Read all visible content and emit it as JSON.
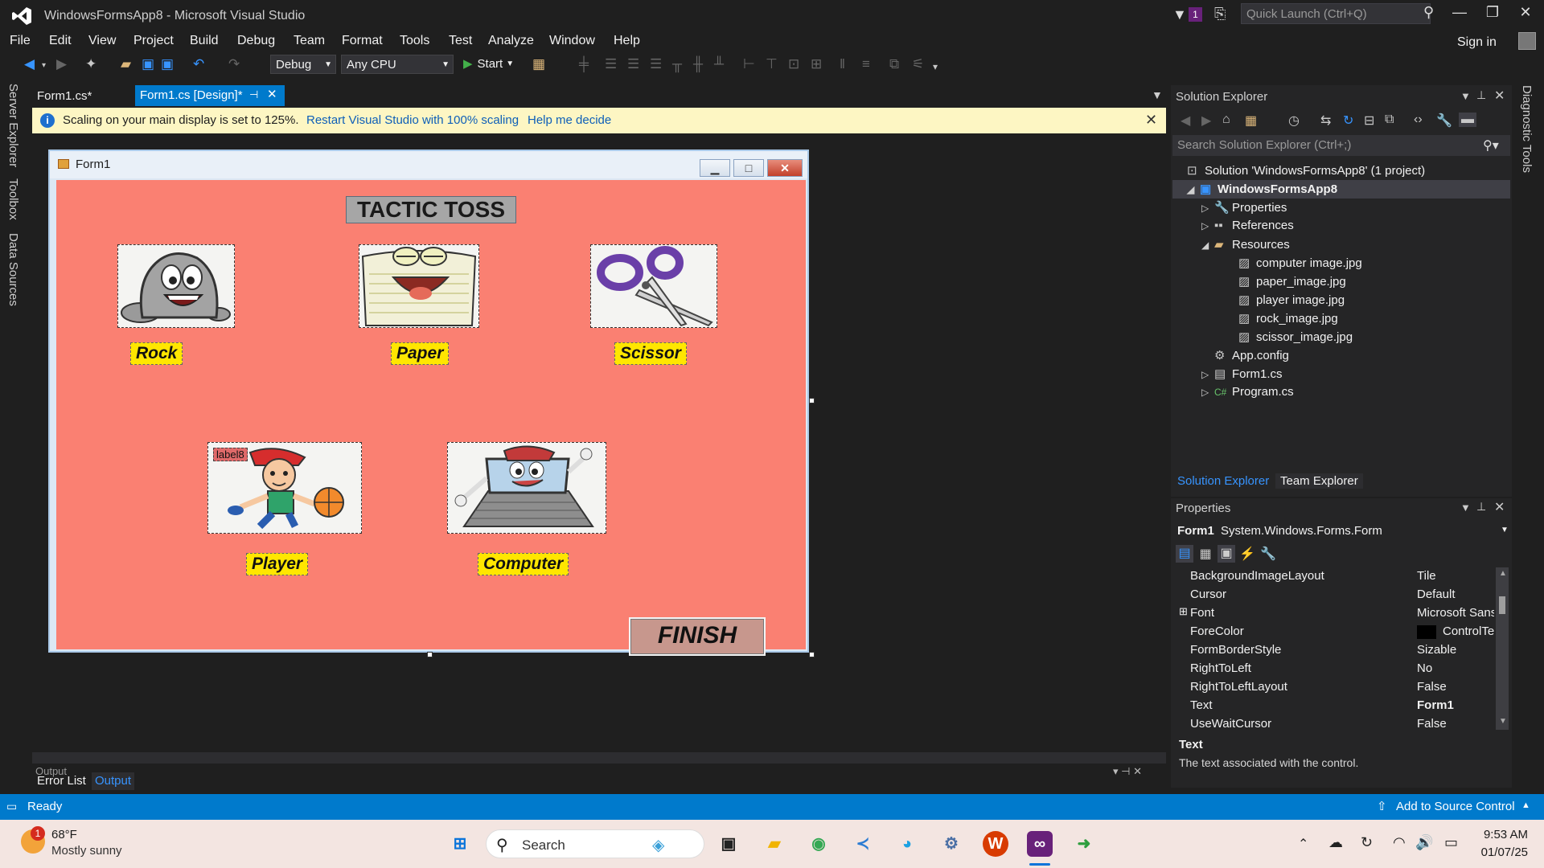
{
  "titlebar": {
    "app_title": "WindowsFormsApp8 - Microsoft Visual Studio",
    "notif_count": "1",
    "quick_launch": "Quick Launch (Ctrl+Q)"
  },
  "menu": [
    "File",
    "Edit",
    "View",
    "Project",
    "Build",
    "Debug",
    "Team",
    "Format",
    "Tools",
    "Test",
    "Analyze",
    "Window",
    "Help"
  ],
  "signin": "Sign in",
  "toolbar": {
    "config": "Debug",
    "platform": "Any CPU",
    "start": "Start"
  },
  "left_rail": [
    "Server Explorer",
    "Toolbox",
    "Data Sources"
  ],
  "right_rail": [
    "Diagnostic Tools"
  ],
  "tabs": {
    "tab1": "Form1.cs*",
    "tab2": "Form1.cs [Design]*"
  },
  "infobar": {
    "text": "Scaling on your main display is set to 125%.",
    "link1": "Restart Visual Studio with 100% scaling",
    "link2": "Help me decide"
  },
  "form": {
    "title": "Form1",
    "game_title": "TACTIC TOSS",
    "labels": {
      "rock": "Rock",
      "paper": "Paper",
      "scissor": "Scissor",
      "player": "Player",
      "computer": "Computer",
      "label8": "label8"
    },
    "finish": "FINISH"
  },
  "bottom": {
    "output_header": "Output",
    "error_list": "Error List",
    "output": "Output"
  },
  "solution_explorer": {
    "title": "Solution Explorer",
    "search": "Search Solution Explorer (Ctrl+;)",
    "solution": "Solution 'WindowsFormsApp8' (1 project)",
    "project": "WindowsFormsApp8",
    "items": {
      "properties": "Properties",
      "references": "References",
      "resources": "Resources",
      "res1": "computer image.jpg",
      "res2": "paper_image.jpg",
      "res3": "player image.jpg",
      "res4": "rock_image.jpg",
      "res5": "scissor_image.jpg",
      "appconfig": "App.config",
      "form1": "Form1.cs",
      "program": "Program.cs"
    },
    "tab_se": "Solution Explorer",
    "tab_te": "Team Explorer"
  },
  "properties": {
    "title": "Properties",
    "object_name": "Form1",
    "object_type": "System.Windows.Forms.Form",
    "rows": [
      {
        "name": "BackgroundImageLayout",
        "value": "Tile"
      },
      {
        "name": "Cursor",
        "value": "Default"
      },
      {
        "name": "Font",
        "value": "Microsoft Sans"
      },
      {
        "name": "ForeColor",
        "value": "ControlTe"
      },
      {
        "name": "FormBorderStyle",
        "value": "Sizable"
      },
      {
        "name": "RightToLeft",
        "value": "No"
      },
      {
        "name": "RightToLeftLayout",
        "value": "False"
      },
      {
        "name": "Text",
        "value": "Form1"
      },
      {
        "name": "UseWaitCursor",
        "value": "False"
      }
    ],
    "desc_title": "Text",
    "desc": "The text associated with the control."
  },
  "status": {
    "ready": "Ready",
    "source_control": "Add to Source Control"
  },
  "taskbar": {
    "weather_temp": "68°F",
    "weather_desc": "Mostly sunny",
    "weather_badge": "1",
    "search": "Search",
    "time": "9:53 AM",
    "date": "01/07/25"
  },
  "colors": {
    "accent": "#007acc",
    "form_back": "#fa8072",
    "label_back": "#ffe600",
    "finish_back": "#c7978d",
    "infobar": "#fdf6c3"
  }
}
